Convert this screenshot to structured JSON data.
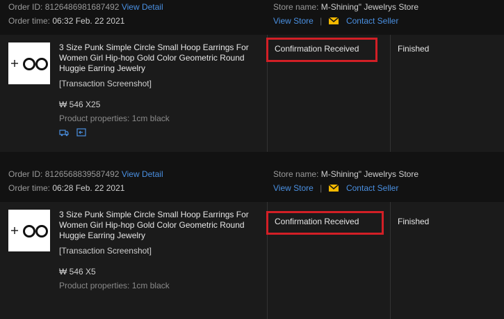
{
  "orders": [
    {
      "order_id_label": "Order ID:",
      "order_id": "8126486981687492",
      "view_detail": "View Detail",
      "order_time_label": "Order time:",
      "order_time": "06:32 Feb. 22 2021",
      "store_name_label": "Store name:",
      "store_name": "M-Shining\" Jewelrys Store",
      "view_store": "View Store",
      "divider": "|",
      "contact_seller": "Contact Seller",
      "product_title": "3 Size Punk Simple Circle Small Hoop Earrings For Women Girl Hip-hop Gold Color Geometric Round Huggie Earring Jewelry",
      "snapshot": "[Transaction Screenshot]",
      "price": "₩ 546 X25",
      "properties": "Product properties: 1cm black",
      "status": "Confirmation Received",
      "result": "Finished"
    },
    {
      "order_id_label": "Order ID:",
      "order_id": "8126568839587492",
      "view_detail": "View Detail",
      "order_time_label": "Order time:",
      "order_time": "06:28 Feb. 22 2021",
      "store_name_label": "Store name:",
      "store_name": "M-Shining\" Jewelrys Store",
      "view_store": "View Store",
      "divider": "|",
      "contact_seller": "Contact Seller",
      "product_title": "3 Size Punk Simple Circle Small Hoop Earrings For Women Girl Hip-hop Gold Color Geometric Round Huggie Earring Jewelry",
      "snapshot": "[Transaction Screenshot]",
      "price": "₩ 546 X5",
      "properties": "Product properties: 1cm black",
      "status": "Confirmation Received",
      "result": "Finished"
    }
  ],
  "colors": {
    "accent_link": "#4a90e2",
    "highlight_box": "#d21f26",
    "mail_icon": "#f5b900"
  }
}
